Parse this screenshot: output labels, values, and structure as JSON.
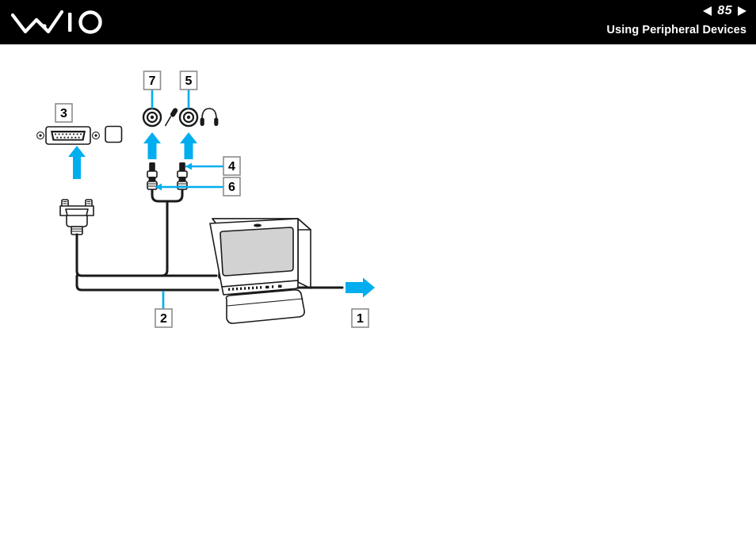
{
  "header": {
    "logo_alt": "VAIO",
    "pager": {
      "prev_icon": "triangle-left-icon",
      "page_number": "85",
      "next_icon": "triangle-right-icon"
    },
    "section_title": "Using Peripheral Devices"
  },
  "figure": {
    "name": "connecting-display-and-audio-diagram",
    "colors": {
      "accent_cyan": "#00AEEF",
      "line_black": "#1a1a1a",
      "screen_gray": "#d2d2d2",
      "callout_border": "#8c8c8c",
      "callout_fill": "#ffffff",
      "body_white": "#ffffff"
    },
    "callouts": [
      {
        "id": "callout-1",
        "label": "1"
      },
      {
        "id": "callout-2",
        "label": "2"
      },
      {
        "id": "callout-3",
        "label": "3"
      },
      {
        "id": "callout-4",
        "label": "4"
      },
      {
        "id": "callout-5",
        "label": "5"
      },
      {
        "id": "callout-6",
        "label": "6"
      },
      {
        "id": "callout-7",
        "label": "7"
      }
    ],
    "ports": {
      "monitor_port": "vga-monitor-port",
      "monitor_symbol": "monitor-symbol-icon",
      "microphone_jack": "microphone-jack-port",
      "microphone_symbol": "microphone-icon",
      "headphone_jack": "headphone-jack-port",
      "headphone_symbol": "headphone-icon"
    },
    "devices": {
      "display": "crt-television-display",
      "vga_plug": "vga-cable-plug",
      "audio_plug_left": "audio-mini-plug-left",
      "audio_plug_right": "audio-mini-plug-right",
      "power_cord_arrow": "power-cord-arrow-right"
    }
  }
}
